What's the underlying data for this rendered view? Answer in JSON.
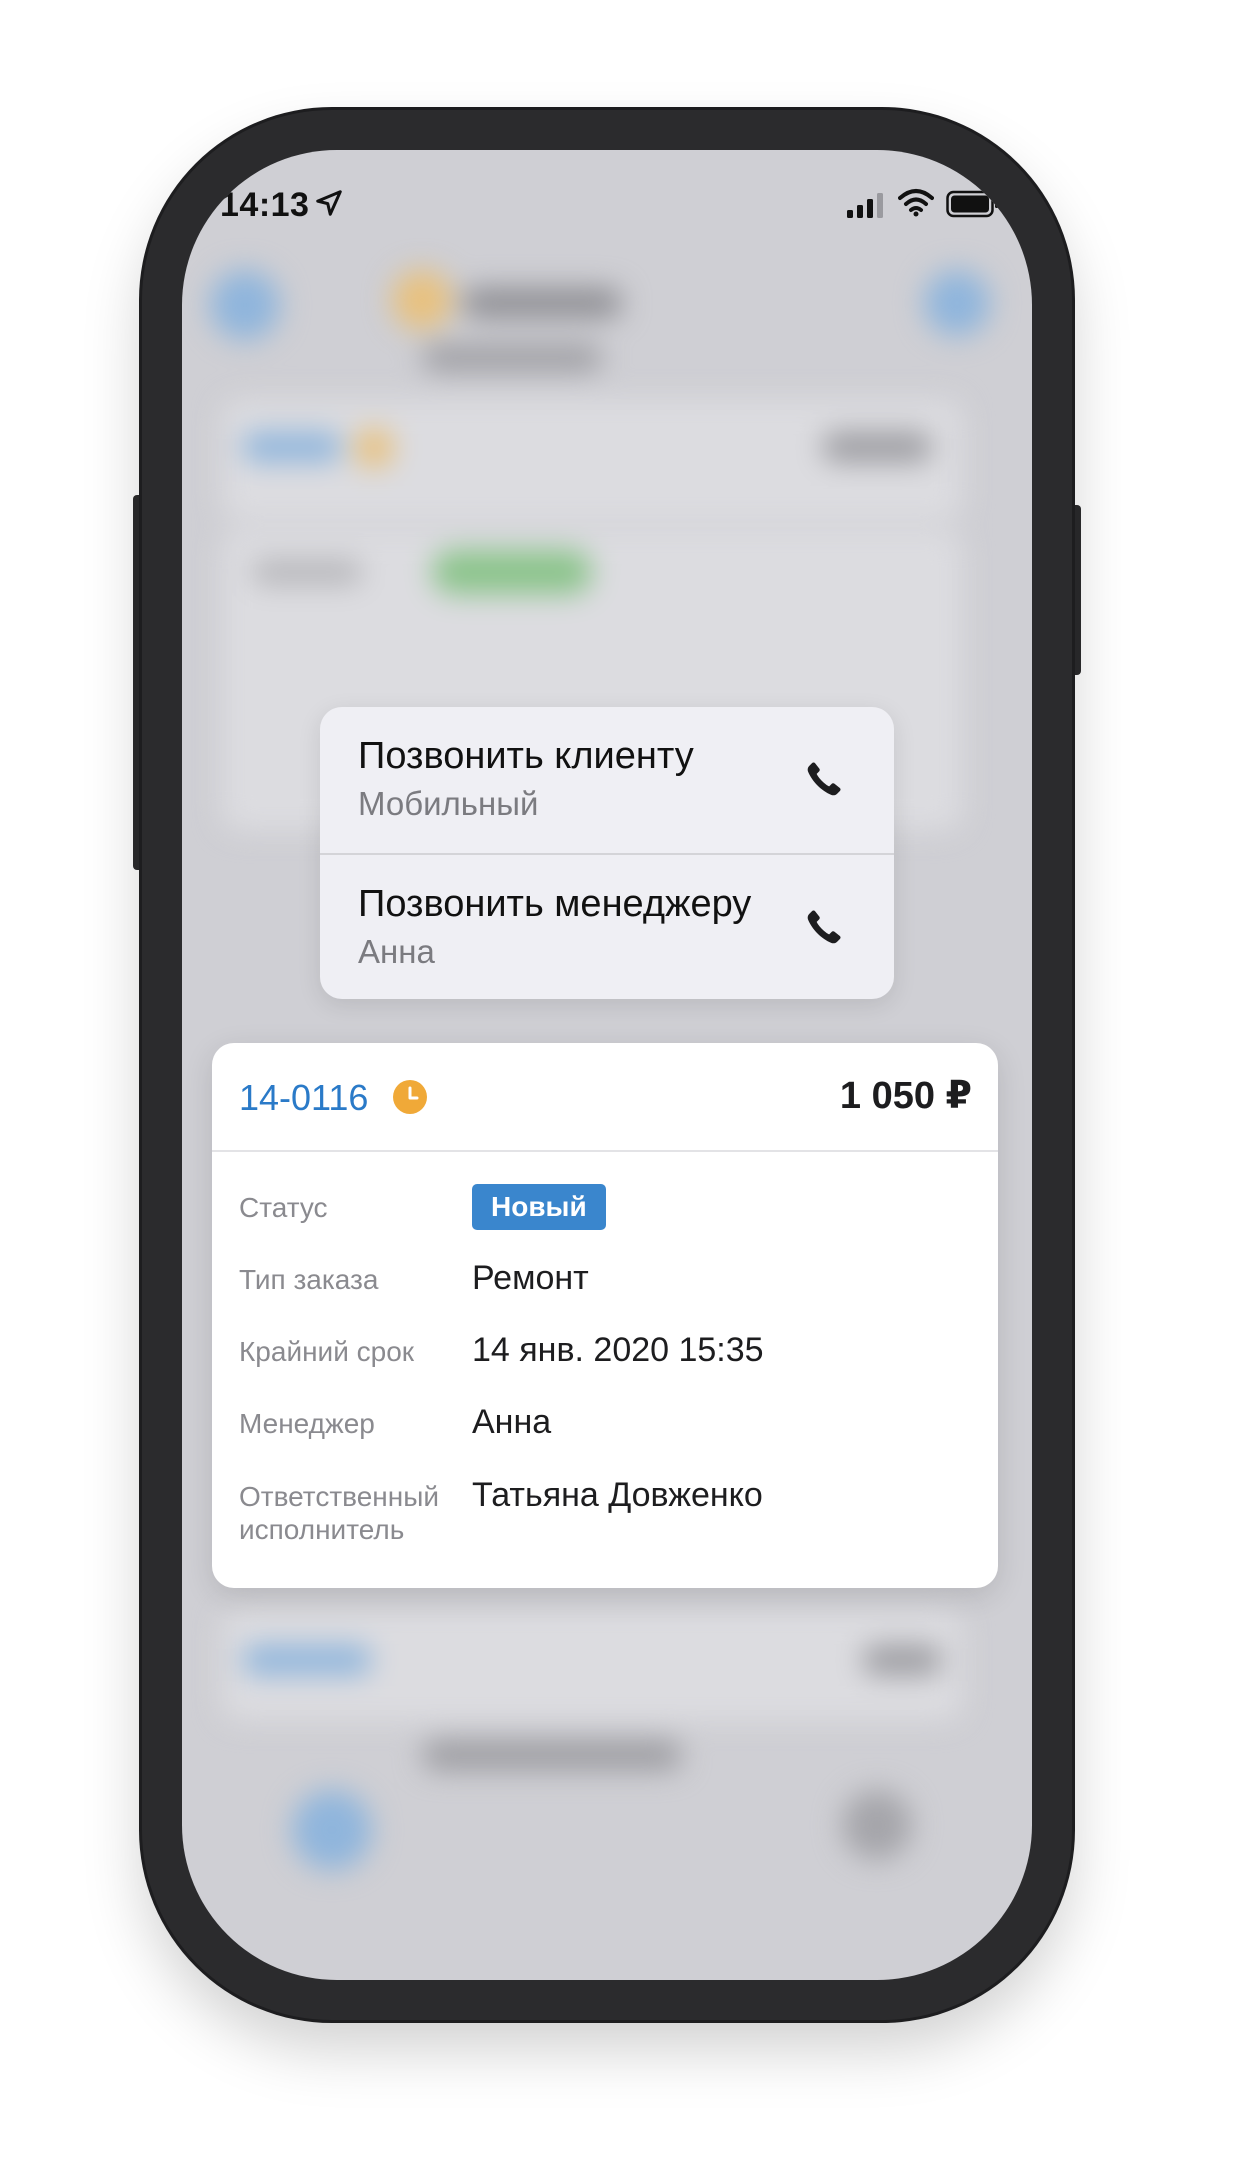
{
  "status_bar": {
    "time": "14:13",
    "icons": [
      "location-arrow-icon",
      "signal-icon",
      "wifi-icon",
      "battery-icon"
    ]
  },
  "context_menu": {
    "items": [
      {
        "title": "Позвонить клиенту",
        "subtitle": "Мобильный",
        "icon": "phone-icon"
      },
      {
        "title": "Позвонить менеджеру",
        "subtitle": "Анна",
        "icon": "phone-icon"
      }
    ]
  },
  "order_card": {
    "number": "14-0116",
    "price": "1 050 ₽",
    "status_label": "Статус",
    "status_value": "Новый",
    "type_label": "Тип заказа",
    "type_value": "Ремонт",
    "deadline_label": "Крайний срок",
    "deadline_value": "14 янв. 2020 15:35",
    "manager_label": "Менеджер",
    "manager_value": "Анна",
    "executor_label_line1": "Ответственный",
    "executor_label_line2": "исполнитель",
    "executor_value": "Татьяна Довженко"
  },
  "colors": {
    "accent_blue": "#2a7ac8",
    "status_badge": "#3a86cd",
    "clock_orange": "#f0a938",
    "phone_frame": "#2b2b2d"
  }
}
